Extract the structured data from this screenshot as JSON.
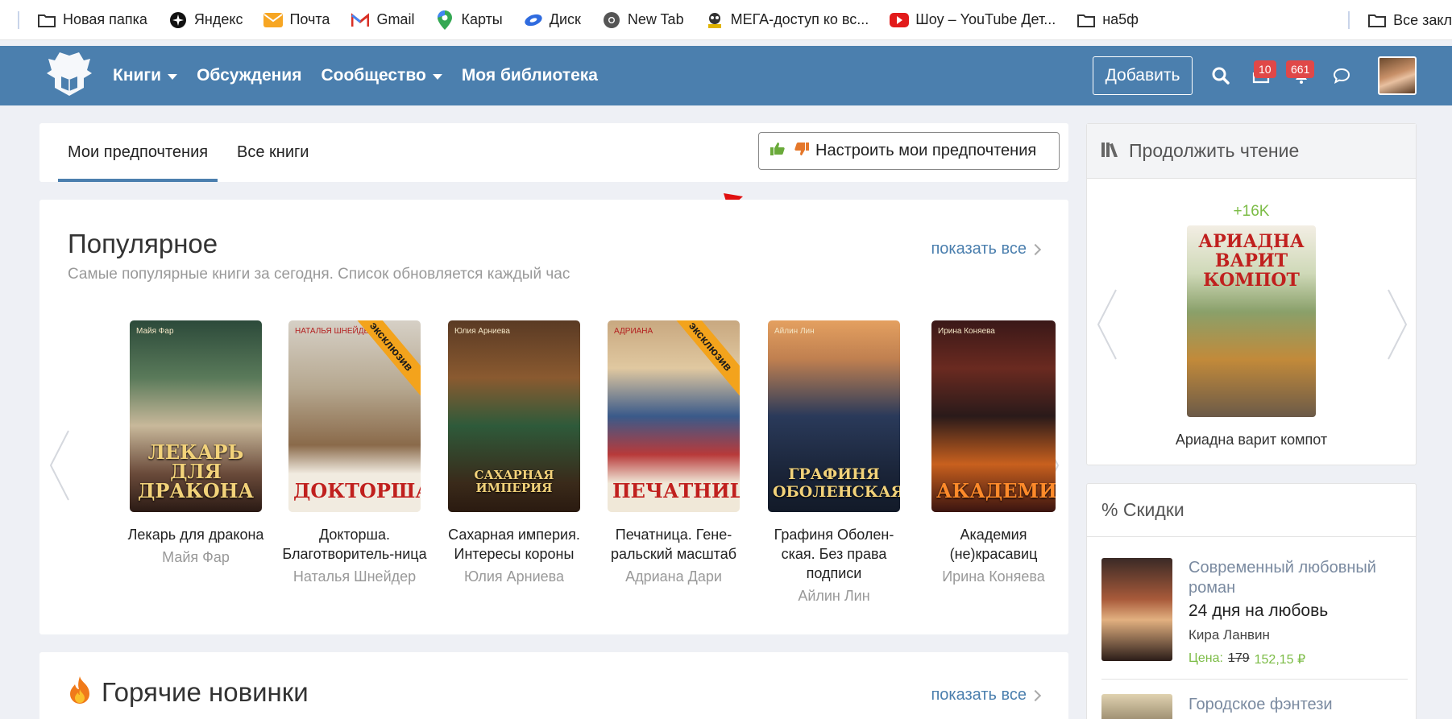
{
  "bookmarks": {
    "items": [
      {
        "label": "Новая папка",
        "icon": "folder-icon"
      },
      {
        "label": "Яндекс",
        "icon": "yandex-icon"
      },
      {
        "label": "Почта",
        "icon": "mail-icon"
      },
      {
        "label": "Gmail",
        "icon": "gmail-icon"
      },
      {
        "label": "Карты",
        "icon": "maps-icon"
      },
      {
        "label": "Диск",
        "icon": "disk-icon"
      },
      {
        "label": "New Tab",
        "icon": "chrome-icon"
      },
      {
        "label": "МЕГА-доступ ко вс...",
        "icon": "mega-icon"
      },
      {
        "label": "Шоу – YouTube Дет...",
        "icon": "youtube-icon"
      },
      {
        "label": "на5ф",
        "icon": "folder-icon"
      }
    ],
    "overflow_label": "Все закл"
  },
  "header": {
    "nav": [
      {
        "label": "Книги",
        "dropdown": true
      },
      {
        "label": "Обсуждения",
        "dropdown": false
      },
      {
        "label": "Сообщество",
        "dropdown": true
      },
      {
        "label": "Моя библиотека",
        "dropdown": false
      }
    ],
    "add_label": "Добавить",
    "badge_library": "10",
    "badge_notifications": "661",
    "accent": "#4b7fae"
  },
  "tabs": {
    "items": [
      "Мои предпочтения",
      "Все книги"
    ],
    "active": 0,
    "pref_button": "Настроить мои предпочтения"
  },
  "popular": {
    "title": "Популярное",
    "subtitle": "Самые популярные книги за сегодня. Список обновляется каждый час",
    "show_all": "показать все",
    "books": [
      {
        "title": "Лекарь для дракона",
        "author": "Майя Фар",
        "cover_text": "ЛЕКАРЬ ДЛЯ ДРАКОНА",
        "cover_author": "Майя Фар",
        "exclusive": false
      },
      {
        "title": "Докторша. Благотворитель-ница",
        "author": "Наталья Шнейдер",
        "cover_text": "ДОКТОРША",
        "cover_author": "НАТАЛЬЯ ШНЕЙДЕР",
        "exclusive": true
      },
      {
        "title": "Сахарная империя. Интересы короны",
        "author": "Юлия Арниева",
        "cover_text": "САХАРНАЯ ИМПЕРИЯ",
        "cover_author": "Юлия Арниева",
        "exclusive": false
      },
      {
        "title": "Печатница. Гене-ральский масштаб",
        "author": "Адриана Дари",
        "cover_text": "ПЕЧАТНИЦА",
        "cover_author": "АДРИАНА",
        "exclusive": true
      },
      {
        "title": "Графиня Оболен-ская. Без права подписи",
        "author": "Айлин Лин",
        "cover_text": "ГРАФИНЯ ОБОЛЕНСКАЯ",
        "cover_author": "Айлин Лин",
        "exclusive": false
      },
      {
        "title": "Академия (не)красавиц",
        "author": "Ирина Коняева",
        "cover_text": "АКАДЕМИЯ",
        "cover_author": "Ирина Коняева",
        "exclusive": false
      }
    ],
    "exclusive_label": "эксклюзив"
  },
  "hot": {
    "title": "Горячие новинки",
    "show_all": "показать все"
  },
  "continue_reading": {
    "title": "Продолжить чтение",
    "views": "+16K",
    "book_title": "Ариадна варит компот",
    "cover_text": "АРИАДНА ВАРИТ КОМПОТ"
  },
  "discounts": {
    "title": "% Скидки",
    "item": {
      "genre": "Современный любовный роман",
      "title": "24 дня на любовь",
      "author": "Кира Ланвин",
      "price_label": "Цена:",
      "old_price": "179",
      "new_price": "152,15 ₽"
    },
    "item2_genre": "Городское фэнтези"
  }
}
